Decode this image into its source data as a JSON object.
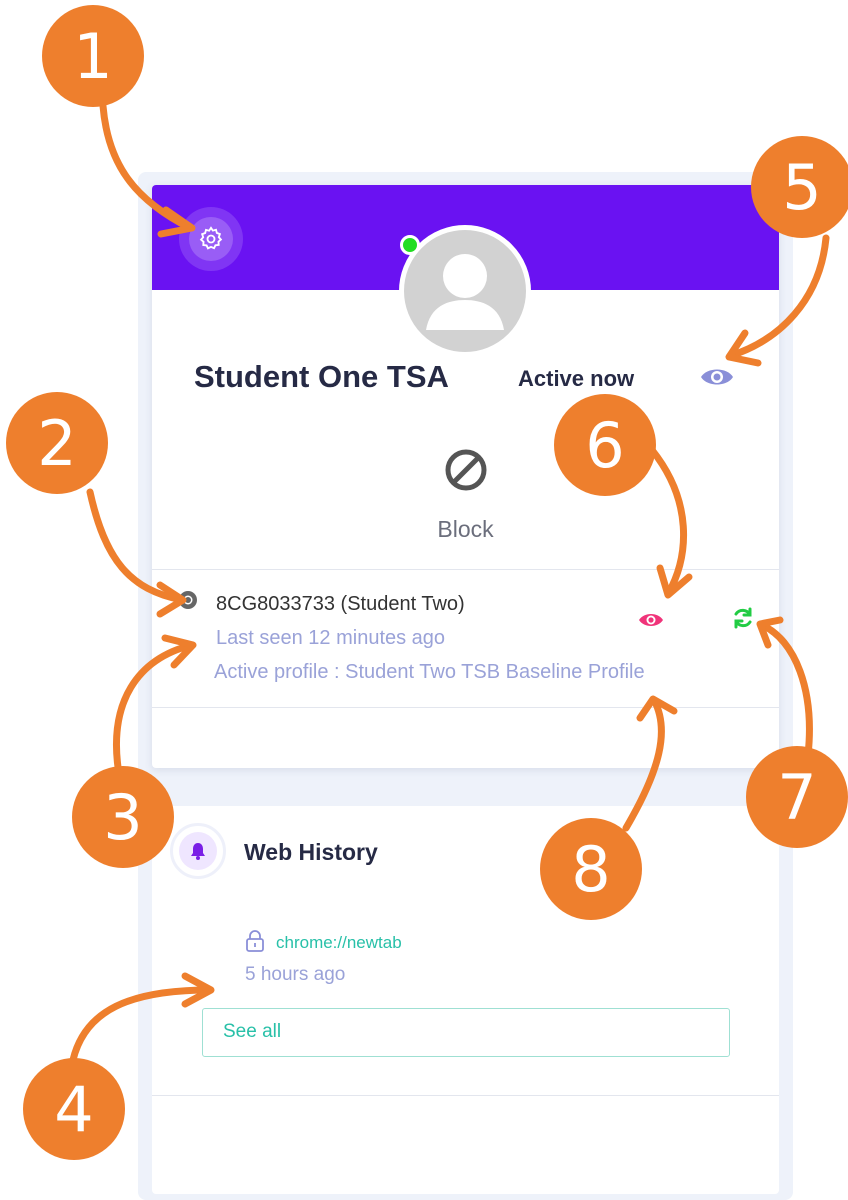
{
  "profile": {
    "name": "Student One TSA",
    "status": "Active now",
    "block_label": "Block"
  },
  "device": {
    "name": "8CG8033733 (Student Two)",
    "last_seen": "Last seen 12 minutes ago",
    "active_profile": "Active profile : Student Two TSB Baseline Profile"
  },
  "web_history": {
    "title": "Web History",
    "entries": [
      {
        "url": "chrome://newtab",
        "time": "5 hours ago"
      }
    ],
    "see_all_label": "See all"
  },
  "callouts": [
    "1",
    "2",
    "3",
    "4",
    "5",
    "6",
    "7",
    "8"
  ],
  "colors": {
    "banner": "#6a12f2",
    "callout": "#ee7f2d",
    "online": "#22dd22",
    "link": "#28c0a8",
    "muted": "#9aa2d8",
    "watch_eye": "#8a8fd8",
    "device_eye": "#f0347a",
    "refresh": "#22cc44"
  },
  "icons": [
    "settings-gear-icon",
    "avatar-icon",
    "online-status-icon",
    "watch-eye-icon",
    "block-icon",
    "chrome-icon",
    "device-eye-icon",
    "refresh-icon",
    "bell-icon",
    "lock-icon"
  ]
}
